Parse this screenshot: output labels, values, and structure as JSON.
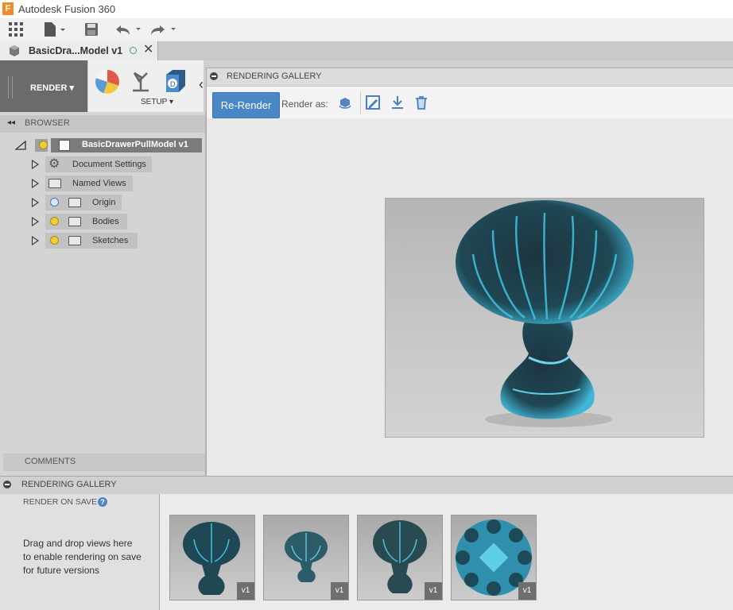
{
  "window": {
    "title": "Autodesk Fusion 360",
    "logo_letter": "F"
  },
  "quick_access": {
    "icons": [
      "apps-grid-icon",
      "file-icon",
      "save-icon",
      "undo-icon",
      "redo-icon"
    ]
  },
  "document_tab": {
    "label": "BasicDra...Model v1"
  },
  "ribbon": {
    "workspace_label": "RENDER ▾",
    "setup_label": "SETUP ▾"
  },
  "browser": {
    "title": "BROWSER",
    "root": {
      "label": "BasicDrawerPullModel v1"
    },
    "items": [
      {
        "label": "Document Settings"
      },
      {
        "label": "Named Views"
      },
      {
        "label": "Origin"
      },
      {
        "label": "Bodies"
      },
      {
        "label": "Sketches"
      }
    ],
    "comments_label": "COMMENTS"
  },
  "gallery_panel": {
    "title": "RENDERING GALLERY",
    "rerender_label": "Re-Render",
    "render_as_label": "Render as:"
  },
  "bottom_gallery": {
    "title": "RENDERING GALLERY",
    "render_on_save": "RENDER ON SAVE",
    "help_symbol": "?",
    "drop_hint": "Drag and drop views here to enable rendering on save for future versions",
    "thumbnails": [
      {
        "version": "v1"
      },
      {
        "version": "v1"
      },
      {
        "version": "v1"
      },
      {
        "version": "v1"
      }
    ]
  },
  "colors": {
    "accent": "#4a87c6",
    "glass": "#2fa9c9"
  }
}
